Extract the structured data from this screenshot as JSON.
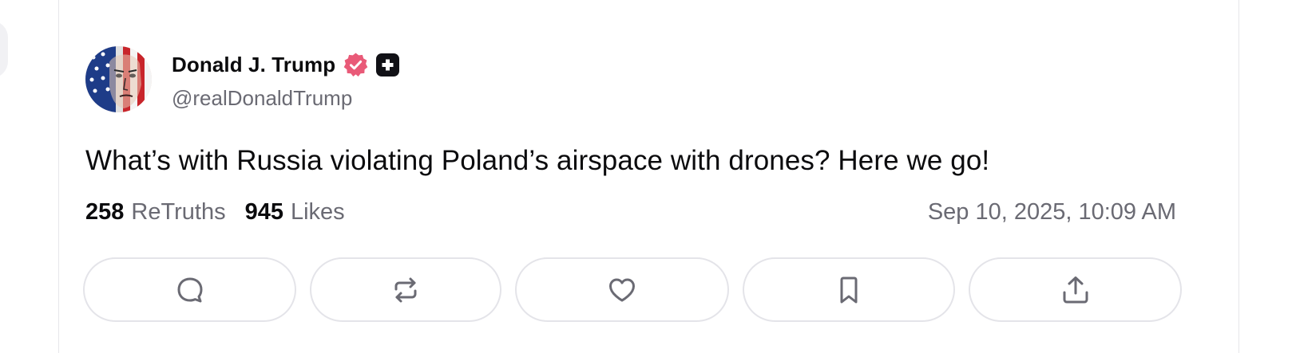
{
  "post": {
    "author": {
      "display_name": "Donald J. Trump",
      "handle": "@realDonaldTrump",
      "verified_color": "#e95a78",
      "plus_badge_color": "#111116"
    },
    "text": "What’s with Russia violating Poland’s airspace with drones? Here we go!",
    "stats": {
      "retruths_count": "258",
      "retruths_label": "ReTruths",
      "likes_count": "945",
      "likes_label": "Likes"
    },
    "timestamp": "Sep 10, 2025, 10:09 AM"
  },
  "actions": [
    {
      "name": "reply",
      "icon": "comment-bubble-icon"
    },
    {
      "name": "retruth",
      "icon": "repost-icon"
    },
    {
      "name": "like",
      "icon": "heart-icon"
    },
    {
      "name": "bookmark",
      "icon": "bookmark-icon"
    },
    {
      "name": "share",
      "icon": "share-upload-icon"
    }
  ],
  "colors": {
    "text_primary": "#0b0b0d",
    "text_secondary": "#6a6a73",
    "border": "#e4e4e9"
  }
}
